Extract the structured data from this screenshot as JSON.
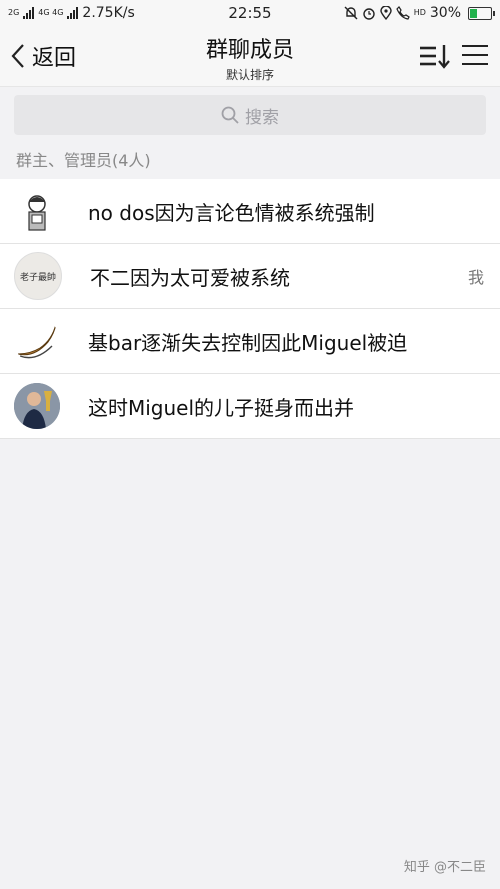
{
  "status_bar": {
    "network_left": "2G",
    "network_mid": "4G 4G",
    "speed": "2.75K/s",
    "time": "22:55",
    "hd": "HD",
    "battery_percent": "30%",
    "battery_level": 0.3
  },
  "nav": {
    "back_label": "返回",
    "title": "群聊成员",
    "subtitle": "默认排序"
  },
  "search": {
    "placeholder": "搜索"
  },
  "section": {
    "header": "群主、管理员(4人)"
  },
  "members": [
    {
      "name": "no dos因为言论色情被系统强制",
      "badge": ""
    },
    {
      "name": "不二因为太可爱被系统",
      "badge": "我"
    },
    {
      "name": "基bar逐渐失去控制因此Miguel被迫",
      "badge": ""
    },
    {
      "name": "这时Miguel的儿子挺身而出并",
      "badge": ""
    }
  ],
  "avatar2_text": "老子最帥",
  "watermark": "知乎 @不二臣",
  "colors": {
    "background": "#f2f2f4",
    "battery_green": "#22b14c",
    "search_bg": "#e6e6e8"
  }
}
